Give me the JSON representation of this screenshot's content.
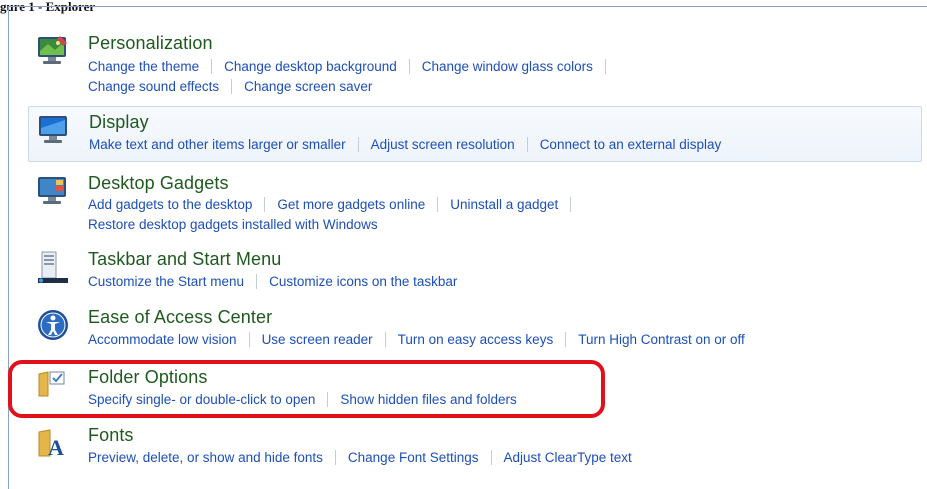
{
  "caption": "gure 1 - Explorer",
  "categories": [
    {
      "title": "Personalization",
      "link_rows": [
        [
          "Change the theme",
          "Change desktop background",
          "Change window glass colors"
        ],
        [
          "Change sound effects",
          "Change screen saver"
        ]
      ],
      "icon": "personalization-icon"
    },
    {
      "title": "Display",
      "link_rows": [
        [
          "Make text and other items larger or smaller",
          "Adjust screen resolution",
          "Connect to an external display"
        ]
      ],
      "icon": "display-icon"
    },
    {
      "title": "Desktop Gadgets",
      "link_rows": [
        [
          "Add gadgets to the desktop",
          "Get more gadgets online",
          "Uninstall a gadget"
        ],
        [
          "Restore desktop gadgets installed with Windows"
        ]
      ],
      "icon": "desktop-gadgets-icon"
    },
    {
      "title": "Taskbar and Start Menu",
      "link_rows": [
        [
          "Customize the Start menu",
          "Customize icons on the taskbar"
        ]
      ],
      "icon": "taskbar-icon"
    },
    {
      "title": "Ease of Access Center",
      "link_rows": [
        [
          "Accommodate low vision",
          "Use screen reader",
          "Turn on easy access keys",
          "Turn High Contrast on or off"
        ]
      ],
      "icon": "ease-of-access-icon"
    },
    {
      "title": "Folder Options",
      "link_rows": [
        [
          "Specify single- or double-click to open",
          "Show hidden files and folders"
        ]
      ],
      "icon": "folder-options-icon"
    },
    {
      "title": "Fonts",
      "link_rows": [
        [
          "Preview, delete, or show and hide fonts",
          "Change Font Settings",
          "Adjust ClearType text"
        ]
      ],
      "icon": "fonts-icon"
    }
  ],
  "colors": {
    "title": "#1e5a1e",
    "link": "#1c4fb8",
    "callout": "#e0111a",
    "hover_background": "#eef4fb"
  }
}
